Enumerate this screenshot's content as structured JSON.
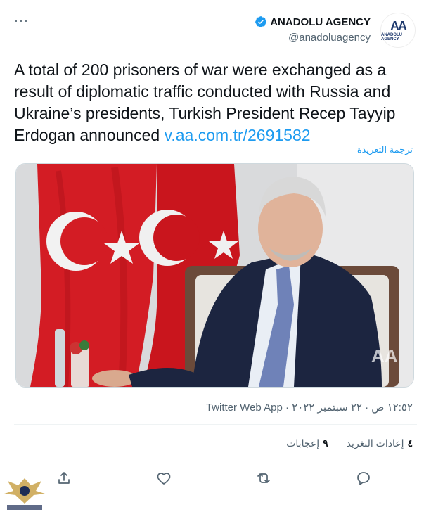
{
  "header": {
    "more_icon": "ellipsis-icon",
    "name": "ANADOLU AGENCY",
    "handle": "@anadoluagency",
    "verified_icon": "verified-badge-icon",
    "avatar_letters": "AA",
    "avatar_caption": "ANADOLU AGENCY"
  },
  "tweet": {
    "text": "A total of 200 prisoners of war were exchanged as a result of diplomatic traffic conducted with Russia and Ukraine’s presidents, Turkish President Recep Tayyip Erdogan announced ",
    "link": "v.aa.com.tr/2691582",
    "translate": "ترجمة التغريدة"
  },
  "meta": {
    "time": "١٢:٥٢ ص",
    "date": "٢٢ سبتمبر ٢٠٢٢",
    "client": "Twitter Web App",
    "separator": "·"
  },
  "stats": {
    "retweets_count": "٤",
    "retweets_label": "إعادات التغريد",
    "likes_count": "٩",
    "likes_label": "إعجابات"
  },
  "actions": [
    "reply-icon",
    "retweet-icon",
    "like-icon",
    "share-icon"
  ],
  "colors": {
    "link": "#1d9bf0",
    "muted": "#536471",
    "flag_red": "#e30a17"
  }
}
